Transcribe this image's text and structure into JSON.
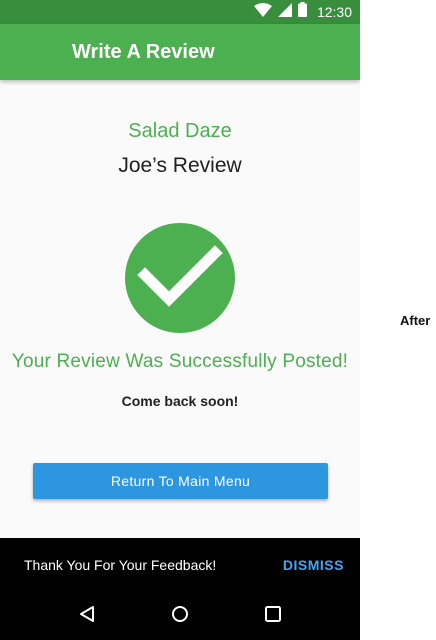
{
  "status_bar": {
    "time": "12:30",
    "icons": [
      "wifi-icon",
      "signal-icon",
      "battery-icon"
    ],
    "color": "#388e3c"
  },
  "app_bar": {
    "title": "Write A Review",
    "color": "#4caf50"
  },
  "main": {
    "restaurant_name": "Salad Daze",
    "review_title": "Joe’s Review",
    "check_icon": "check-circle-icon",
    "success_message": "Your Review Was Successfully Posted!",
    "sub_message": "Come back soon!",
    "main_menu_button_label": "Return To Main Menu",
    "button_color": "#2d96e0"
  },
  "snackbar": {
    "message": "Thank You For Your Feedback!",
    "action_label": "DISMISS",
    "action_color": "#42a5f5"
  },
  "nav_bar": {
    "icons": [
      "back-icon",
      "home-icon",
      "recents-icon"
    ]
  },
  "caption": {
    "label": "After"
  }
}
